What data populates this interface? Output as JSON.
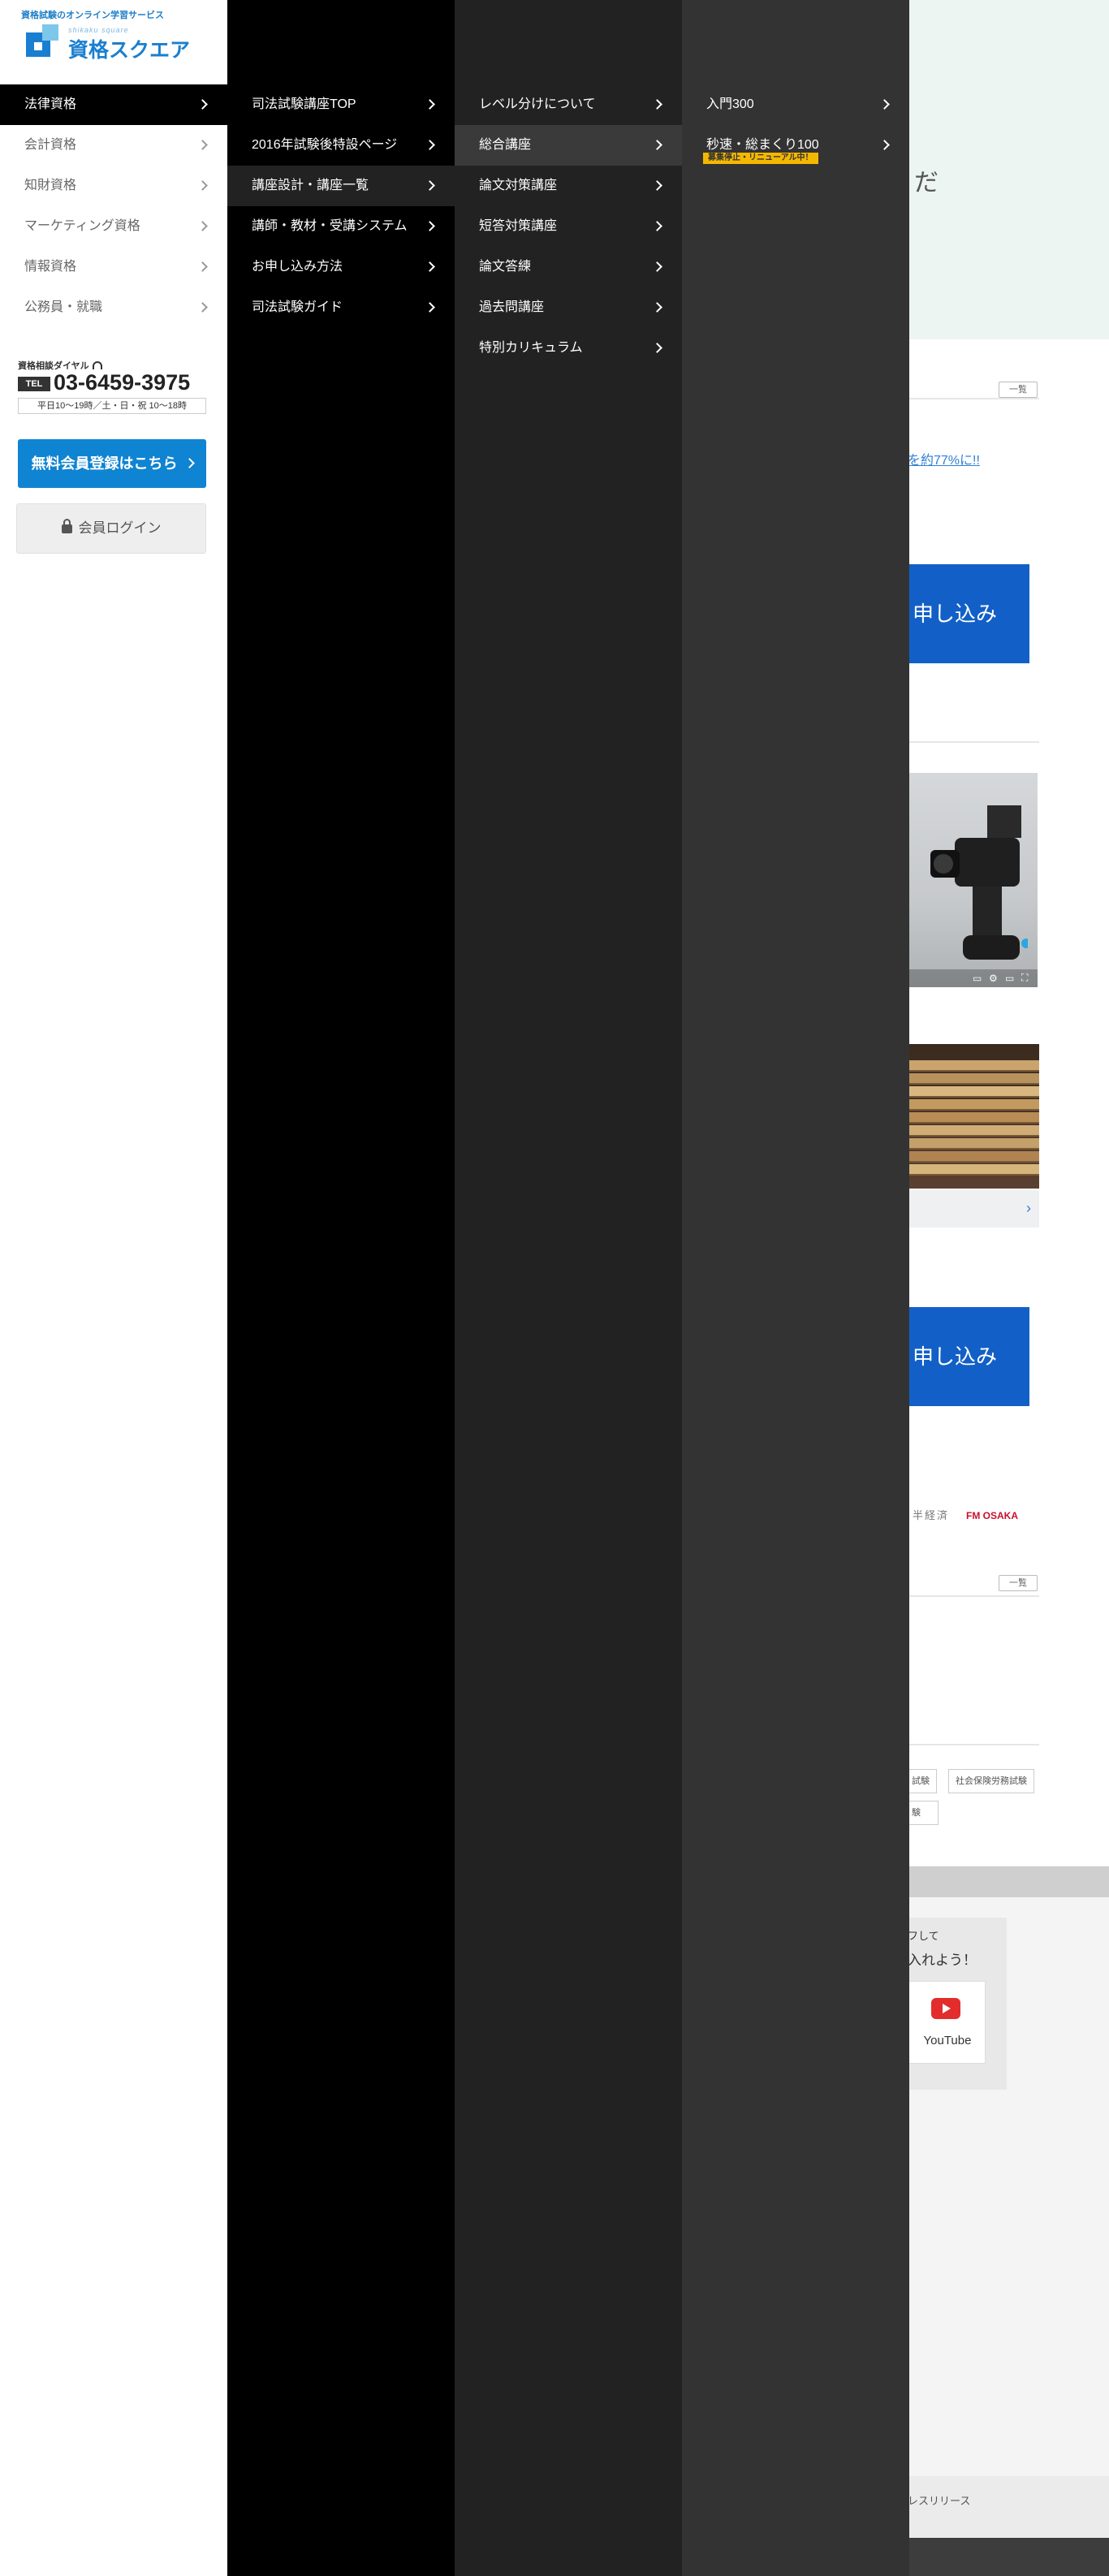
{
  "logo": {
    "tagline": "資格試験のオンライン学習サービス",
    "sub": "shikaku square",
    "name": "資格スクエア"
  },
  "menu_level1": [
    {
      "label": "法律資格"
    },
    {
      "label": "会計資格"
    },
    {
      "label": "知財資格"
    },
    {
      "label": "マーケティング資格"
    },
    {
      "label": "情報資格"
    },
    {
      "label": "公務員・就職"
    }
  ],
  "contact": {
    "dial_label": "資格相談ダイヤル",
    "tel_label": "TEL",
    "tel_number": "03-6459-3975",
    "hours": "平日10〜19時／土・日・祝 10〜18時"
  },
  "buttons": {
    "register": "無料会員登録はこちら",
    "login": "会員ログイン"
  },
  "menu_level2": [
    {
      "label": "司法試験講座TOP"
    },
    {
      "label": "2016年試験後特設ページ"
    },
    {
      "label": "講座設計・講座一覧"
    },
    {
      "label": "講師・教材・受講システム"
    },
    {
      "label": "お申し込み方法"
    },
    {
      "label": "司法試験ガイド"
    }
  ],
  "menu_level3": [
    {
      "label": "レベル分けについて"
    },
    {
      "label": "総合講座"
    },
    {
      "label": "論文対策講座"
    },
    {
      "label": "短答対策講座"
    },
    {
      "label": "論文答練"
    },
    {
      "label": "過去問講座"
    },
    {
      "label": "特別カリキュラム"
    }
  ],
  "menu_level4": [
    {
      "label": "入門300"
    },
    {
      "label": "秒速・総まくり100",
      "badge": "募集停止・リニューアル中！"
    }
  ],
  "background": {
    "hero_text": "だ",
    "ichiran": "一覧",
    "link_text": "を約77%に!!",
    "apply_text": "申し込み",
    "media_logo1": "半経済",
    "media_logo2": "FM OSAKA",
    "tags": [
      "試験",
      "社会保険労務試験",
      "験"
    ],
    "sns_line1": "フして",
    "sns_line2": "入れよう！",
    "youtube": "YouTube",
    "press": "レスリリース"
  }
}
